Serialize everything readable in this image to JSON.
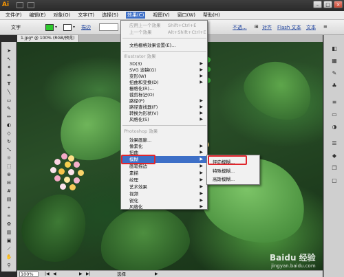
{
  "app": {
    "logo": "Ai"
  },
  "window_buttons": [
    "–",
    "□",
    "×"
  ],
  "menubar": [
    "文件(F)",
    "编辑(E)",
    "对象(O)",
    "文字(T)",
    "选择(S)",
    "效果(C)",
    "视图(V)",
    "窗口(W)",
    "帮助(H)"
  ],
  "control_bar": {
    "label": "文字",
    "stroke_label": "描边",
    "opacity_label": "不透...",
    "align_label": "对齐",
    "flash_text_label": "Flash 文本",
    "format_label": "文本"
  },
  "document_tab": "1.jpg* @ 100% (RGB/预览)",
  "effects_menu": {
    "apply_last": {
      "label": "应用上一个效果",
      "shortcut": "Shift+Ctrl+E"
    },
    "last_effect": {
      "label": "上一个效果",
      "shortcut": "Alt+Shift+Ctrl+E"
    },
    "raster_settings": "文档栅格效果设置(E)...",
    "illustrator_section": "Illustrator 效果",
    "illustrator_items": [
      "3D(3)",
      "SVG 滤镜(G)",
      "变形(W)",
      "扭曲和变换(D)",
      "栅格化(R)...",
      "裁剪标记(O)",
      "路径(P)",
      "路径查找器(F)",
      "转换为形状(V)",
      "风格化(S)"
    ],
    "photoshop_section": "Photoshop 效果",
    "photoshop_items": [
      "效果画廊...",
      "像素化",
      "扭曲",
      "模糊",
      "画笔描边",
      "素描",
      "纹理",
      "艺术效果",
      "视频",
      "锐化",
      "风格化"
    ],
    "highlighted": "模糊"
  },
  "blur_submenu": [
    "径向模糊...",
    "特殊模糊...",
    "高斯模糊..."
  ],
  "statusbar": {
    "zoom": "100%",
    "tool_label": "选择"
  },
  "watermark": {
    "text": "Baidu 经验",
    "sub": "jingyan.baidu.com"
  },
  "colors": {
    "fill": "#2ec82e",
    "highlight": "#3d6fc7",
    "annotation": "#e0262c"
  }
}
